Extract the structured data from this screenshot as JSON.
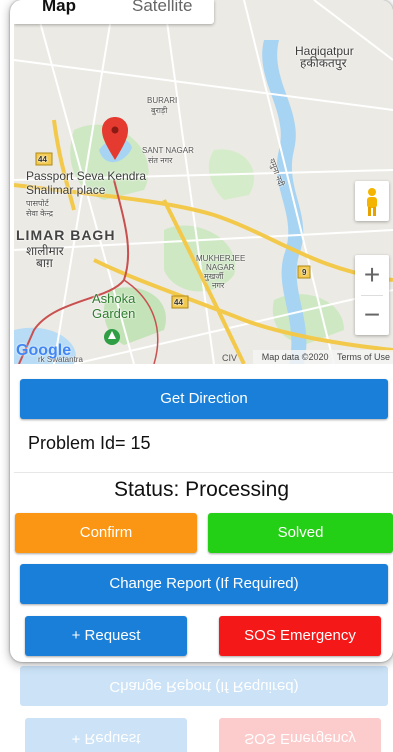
{
  "map": {
    "type_tabs": [
      "Map",
      "Satellite"
    ],
    "labels": {
      "haqiqatpur": "Haqiqatpur",
      "haqiqatpur_hi": "हकीकतपुर",
      "burari": "BURARI",
      "burari_hi": "बुराड़ी",
      "sant_nagar": "SANT NAGAR",
      "sant_nagar_hi": "संत नगर",
      "passport": "Passport Seva Kendra",
      "shalimar_place": "Shalimar place",
      "passport_hi": "पासपोर्ट",
      "seva_kendra_hi": "सेवा केन्द्र",
      "limar_bagh": "LIMAR BAGH",
      "shalimar_hi": "शालीमार",
      "bagh_hi": "बाग़",
      "yamuna_hi": "यमुना नदी",
      "mukherjee": "MUKHERJEE",
      "nagar": "NAGAR",
      "mukherjee_hi": "मुखर्जी",
      "nagar_hi": "नगर",
      "ashoka": "Ashoka",
      "garden": "Garden",
      "sw": "rk Swatantra",
      "road_44": "44",
      "road_9": "9",
      "civ": "CIV"
    },
    "google_logo": "Google",
    "attribution": [
      "Map data ©2020",
      "Terms of Use"
    ],
    "zoom_in": "+",
    "zoom_out": "−",
    "colors": {
      "land": "#eceae4",
      "park": "#c9e6c0",
      "water": "#a8d4f3",
      "highway": "#f8d66a",
      "boundary": "#c8504f",
      "marker": "#e53a30"
    }
  },
  "actions": {
    "get_direction": "Get Direction",
    "confirm": "Confirm",
    "solved": "Solved",
    "change_report": "Change Report (If Required)",
    "request": "+ Request",
    "sos": "SOS Emergency"
  },
  "details": {
    "problem_id": "Problem Id= 15",
    "status": "Status: Processing"
  },
  "colors": {
    "primary": "#1a7fd8",
    "confirm": "#fa9613",
    "solved": "#24d015",
    "sos": "#f51818"
  }
}
